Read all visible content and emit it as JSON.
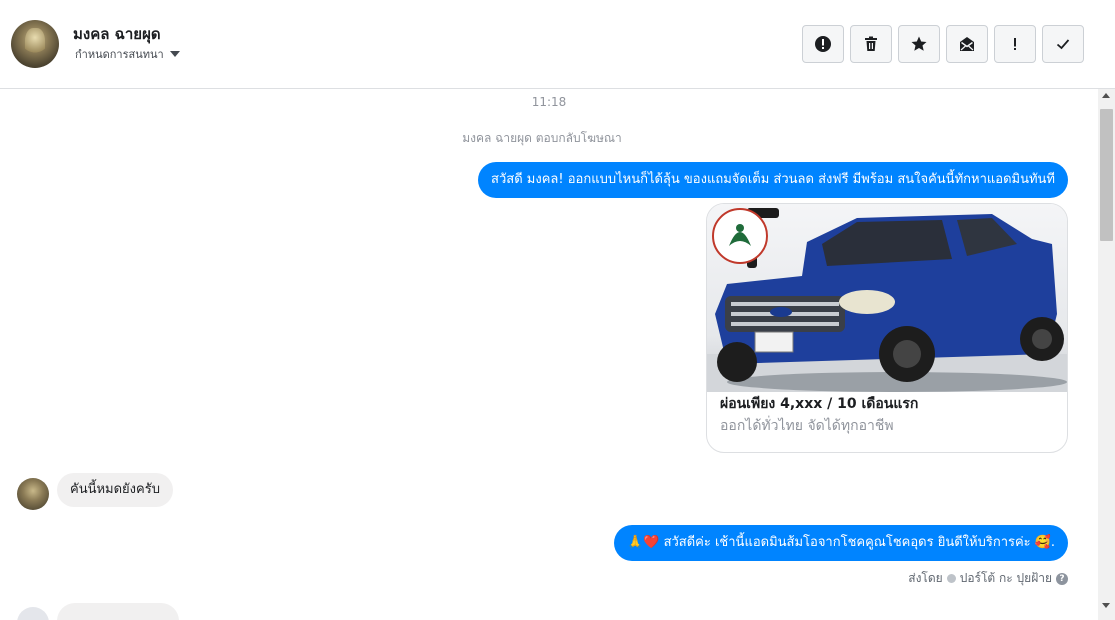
{
  "header": {
    "contact_name": "มงคล ฉายผุด",
    "assign_label": "กำหนดการสนทนา"
  },
  "thread": {
    "timestamp": "11:18",
    "ad_reply_notice": "มงคล ฉายผุด ตอบกลับโฆษณา",
    "messages": [
      {
        "text": "สวัสดี มงคล! ออกแบบไหนก็ได้ลุ้น ของแถมจัดเต็ม ส่วนลด ส่งฟรี มีพร้อม สนใจคันนี้ทักหาแอดมินทันที"
      },
      {
        "text": "คันนี้หมดยังครับ"
      },
      {
        "prefix": "🙏❤️",
        "text": "สวัสดีค่ะ เช้านี้แอดมินส้มโอจากโชคคูณโชคอุดร ยินดีให้บริการค่ะ ",
        "suffix": "🥰."
      }
    ],
    "ad_card": {
      "title": "ผ่อนเพียง 4,xxx / 10 เดือนแรก",
      "subtitle": "ออกได้ทั่วไทย จัดได้ทุกอาชีพ"
    },
    "sent_by": {
      "label": "ส่งโดย",
      "agent": "ปอร์โต้ กะ ปุยฝ้าย",
      "help_glyph": "?"
    }
  },
  "icons": {
    "mark_spam": "alert-circle-icon",
    "delete": "trash-icon",
    "star": "star-icon",
    "mark_unread": "envelope-open-icon",
    "important": "exclamation-icon",
    "mark_done": "check-icon"
  }
}
